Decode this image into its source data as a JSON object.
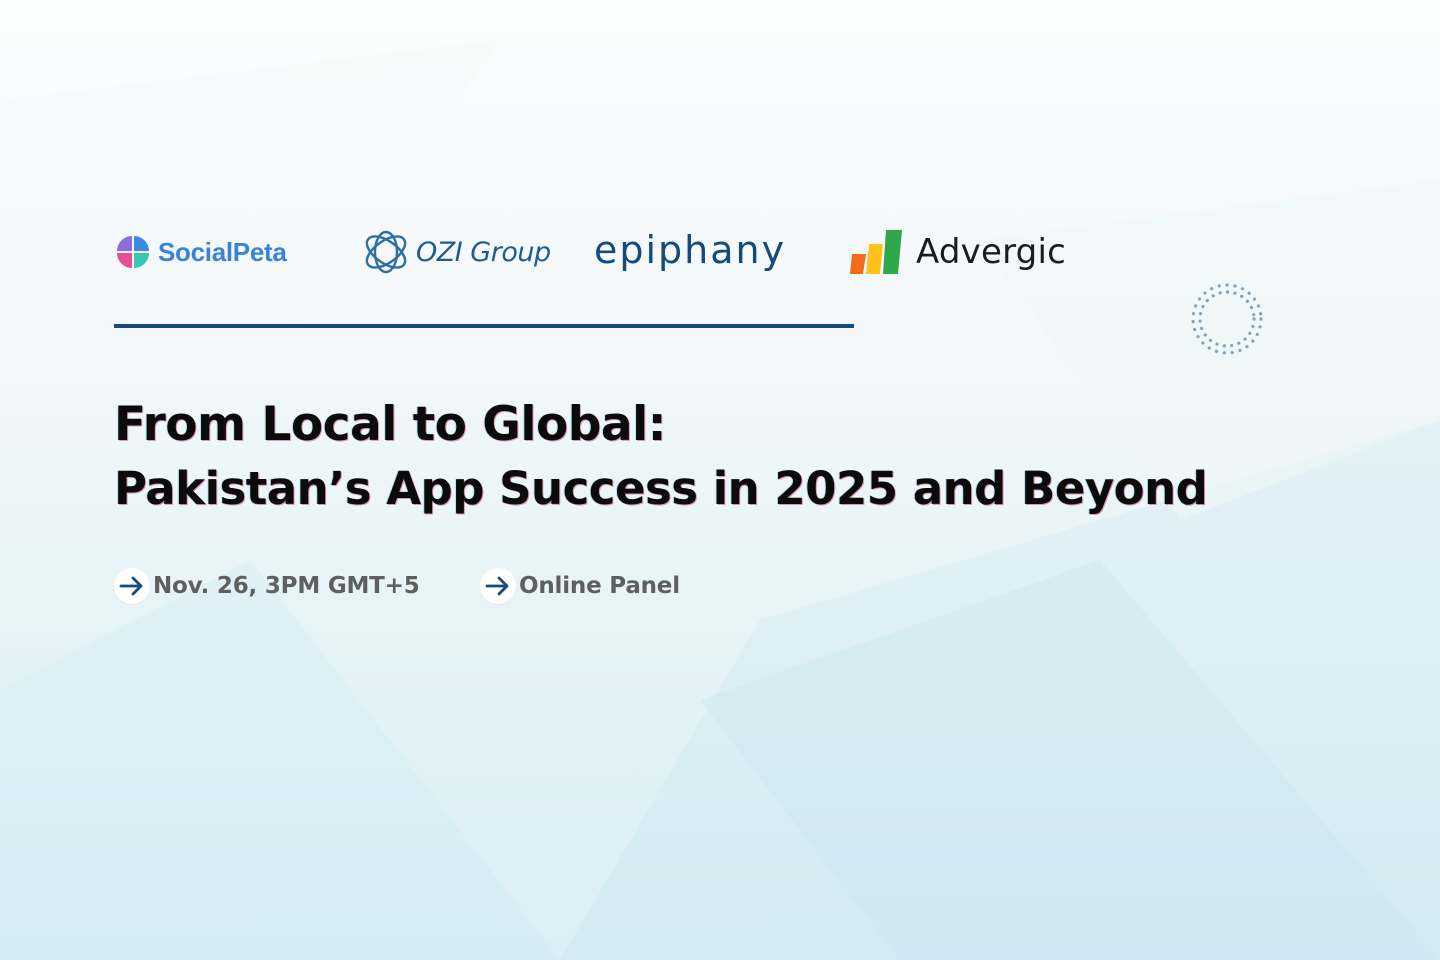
{
  "logos": {
    "socialpeta": "SocialPeta",
    "ozi": "OZI Group",
    "epiphany": "epiphany",
    "advergic": "Advergic"
  },
  "headline": {
    "line1": "From Local to Global:",
    "line2": "Pakistan’s App Success in 2025 and Beyond"
  },
  "event": {
    "date": "Nov. 26, 3PM GMT+5",
    "format": "Online Panel"
  },
  "icons": {
    "bullet": "arrow-right-icon",
    "decoration": "dotted-ring-icon"
  },
  "colors": {
    "accent": "#134c7c",
    "headline": "#0b0b0b",
    "meta_text": "#5f5f5f"
  }
}
